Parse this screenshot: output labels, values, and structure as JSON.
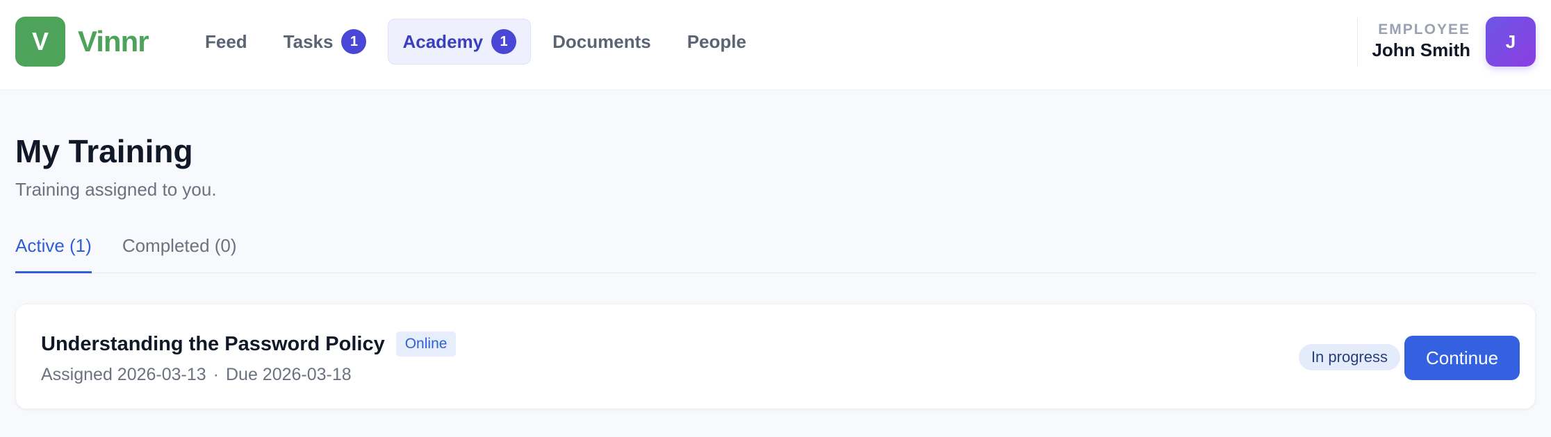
{
  "brand": {
    "logo_letter": "V",
    "name": "Vinnr",
    "color": "#4ea35a"
  },
  "nav": {
    "items": [
      {
        "label": "Feed",
        "badge": ""
      },
      {
        "label": "Tasks",
        "badge": "1"
      },
      {
        "label": "Academy",
        "badge": "1",
        "active": true
      },
      {
        "label": "Documents",
        "badge": ""
      },
      {
        "label": "People",
        "badge": ""
      }
    ]
  },
  "user": {
    "role": "EMPLOYEE",
    "name": "John Smith",
    "avatar_initial": "J"
  },
  "page": {
    "title": "My Training",
    "subtitle": "Training assigned to you."
  },
  "tabs": [
    {
      "label": "Active (1)",
      "active": true
    },
    {
      "label": "Completed (0)",
      "active": false
    }
  ],
  "training": {
    "title": "Understanding the Password Policy",
    "format": "Online",
    "assigned": "Assigned 2026-03-13",
    "separator": "·",
    "due": "Due 2026-03-18",
    "status": "In progress",
    "action_label": "Continue"
  },
  "colors": {
    "accent": "#3461e0",
    "nav_active": "#3a3fc2",
    "badge": "#4a46d6"
  }
}
